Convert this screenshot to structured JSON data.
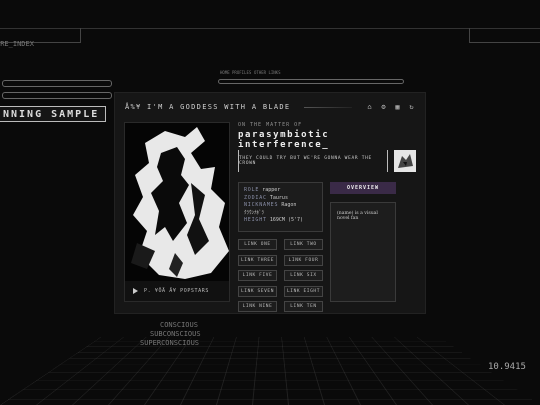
{
  "background": {
    "index_label": "ORE_INDEX",
    "banner": "NNING SAMPLE",
    "nav": [
      "HOME",
      "PROFILES",
      "OTHER LINKS"
    ],
    "labels": [
      "CONSCIOUS",
      "SUBCONSCIOUS",
      "SUPERCONSCIOUS"
    ],
    "counter": "10.9415"
  },
  "panel": {
    "title": "Å%¥ I'M A GODDESS WITH A BLADE",
    "icons": [
      "home-icon",
      "gear-icon",
      "grid-icon",
      "refresh-icon"
    ]
  },
  "profile": {
    "pretitle": "ON THE MATTER OF",
    "name": "parasymbiotic interference_",
    "quote": "THEY COULD TRY BUT WE'RE GONNA WEAR THE CROWN",
    "song": "P. ¥ÖÄ Ä¥ POPSTARS",
    "info": [
      {
        "label": "ROLE",
        "value": "rapper"
      },
      {
        "label": "ZODIAC",
        "value": "Taurus"
      },
      {
        "label": "NICKNAMES",
        "value": "Ragon"
      },
      {
        "label": "",
        "value": "ｸﾗｳﾝﾅﾎﾞﾗ"
      },
      {
        "label": "HEIGHT",
        "value": "169CM (5'7)"
      }
    ],
    "links": [
      "LINK ONE",
      "LINK TWO",
      "LINK THREE",
      "LINK FOUR",
      "LINK FIVE",
      "LINK SIX",
      "LINK SEVEN",
      "LINK EIGHT",
      "LINK NINE",
      "LINK TEN"
    ],
    "overview_tab": "OVERVIEW",
    "overview_text": "(name) is a visual novel fan"
  },
  "colors": {
    "accent": "#3a2a47",
    "label": "#8a8fa8"
  }
}
